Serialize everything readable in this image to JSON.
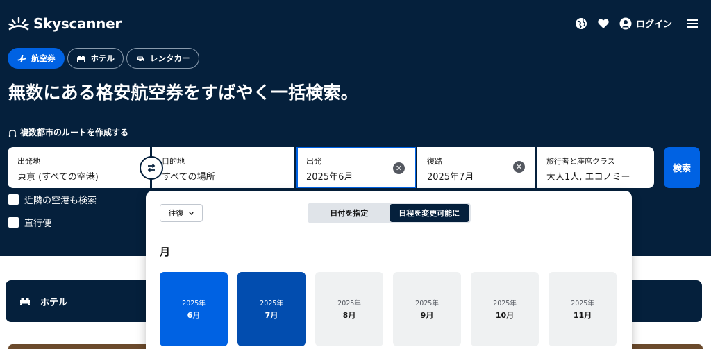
{
  "header": {
    "brand": "Skyscanner",
    "login_label": "ログイン"
  },
  "tabs": [
    {
      "label": "航空券",
      "icon": "plane-icon",
      "active": true
    },
    {
      "label": "ホテル",
      "icon": "bed-icon",
      "active": false
    },
    {
      "label": "レンタカー",
      "icon": "car-icon",
      "active": false
    }
  ],
  "headline": "無数にある格安航空券をすばやく一括検索。",
  "multicity_link": "複数都市のルートを作成する",
  "search": {
    "origin": {
      "label": "出発地",
      "value": "東京 (すべての空港)"
    },
    "destination": {
      "label": "目的地",
      "value": "すべての場所"
    },
    "depart": {
      "label": "出発",
      "value": "2025年6月"
    },
    "return": {
      "label": "復路",
      "value": "2025年7月"
    },
    "travellers": {
      "label": "旅行者と座席クラス",
      "value": "大人1人, エコノミー"
    },
    "search_button": "検索"
  },
  "options": {
    "nearby": "近隣の空港も検索",
    "direct": "直行便"
  },
  "calendar": {
    "trip_type": "往復",
    "mode_specific": "日付を指定",
    "mode_flexible": "日程を変更可能に",
    "section_title": "月",
    "months": [
      {
        "year": "2025年",
        "month": "6月",
        "state": "selected-start"
      },
      {
        "year": "2025年",
        "month": "7月",
        "state": "selected-end"
      },
      {
        "year": "2025年",
        "month": "8月",
        "state": "normal"
      },
      {
        "year": "2025年",
        "month": "9月",
        "state": "normal"
      },
      {
        "year": "2025年",
        "month": "10月",
        "state": "normal"
      },
      {
        "year": "2025年",
        "month": "11月",
        "state": "normal"
      }
    ]
  },
  "hotel_card": {
    "label": "ホテル"
  },
  "colors": {
    "navy": "#05203c",
    "primary": "#0062e3",
    "selected_dark": "#024daf"
  }
}
